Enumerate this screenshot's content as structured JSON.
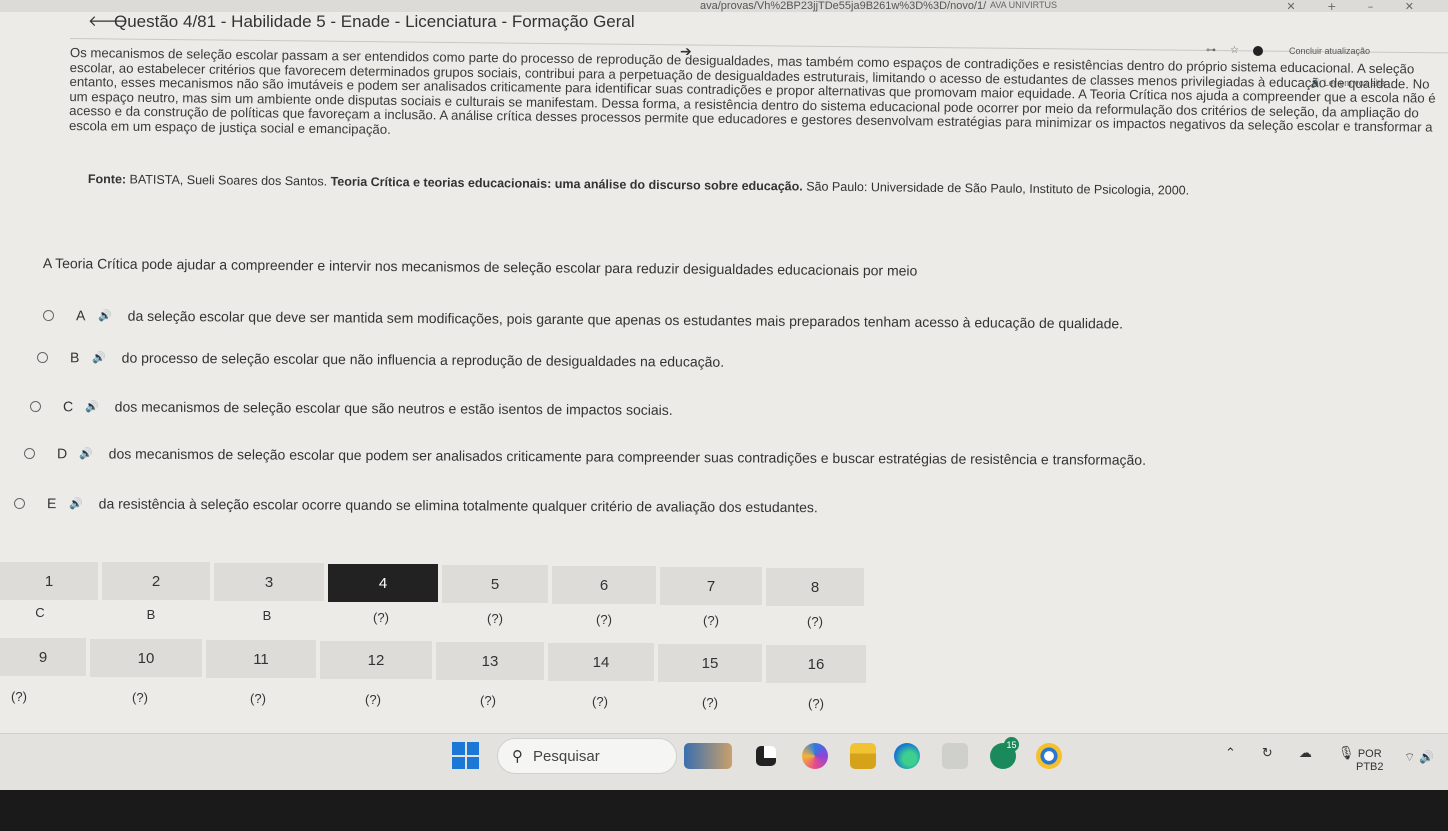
{
  "browser": {
    "url": "ava/provas/Vh%2BP23jjTDe55ja9B261w%3D%3D/novo/1/",
    "tab_label": "AVA UNIVIRTUS",
    "controls": [
      "✕",
      "+",
      "–",
      "✕"
    ]
  },
  "header": {
    "title": "Questão 4/81 - Habilidade 5 - Enade - Licenciatura - Formação Geral",
    "conclude_label": "Concluir atualização",
    "read_aloud_label": "Ler em voz alta"
  },
  "passage": "Os mecanismos de seleção escolar passam a ser entendidos como parte do processo de reprodução de desigualdades, mas também como espaços de contradições e resistências dentro do próprio sistema educacional. A seleção escolar, ao estabelecer critérios que favorecem determinados grupos sociais, contribui para a perpetuação de desigualdades estruturais, limitando o acesso de estudantes de classes menos privilegiadas à educação de qualidade. No entanto, esses mecanismos não são imutáveis e podem ser analisados criticamente para identificar suas contradições e propor alternativas que promovam maior equidade. A Teoria Crítica nos ajuda a compreender que a escola não é um espaço neutro, mas sim um ambiente onde disputas sociais e culturais se manifestam. Dessa forma, a resistência dentro do sistema educacional pode ocorrer por meio da reformulação dos critérios de seleção, da ampliação do acesso e da construção de políticas que favoreçam a inclusão. A análise crítica desses processos permite que educadores e gestores desenvolvam estratégias para minimizar os impactos negativos da seleção escolar e transformar a escola em um espaço de justiça social e emancipação.",
  "source": {
    "label": "Fonte:",
    "author": "BATISTA, Sueli Soares dos Santos.",
    "title": "Teoria Crítica e teorias educacionais: uma análise do discurso sobre educação.",
    "publisher": "São Paulo: Universidade de São Paulo, Instituto de Psicologia, 2000."
  },
  "prompt": "A Teoria Crítica pode ajudar a compreender e intervir nos mecanismos de seleção escolar para reduzir desigualdades educacionais por meio",
  "options": [
    {
      "letter": "A",
      "text": "da seleção escolar que deve ser mantida sem modificações, pois garante que apenas os estudantes mais preparados tenham acesso à educação de qualidade."
    },
    {
      "letter": "B",
      "text": "do processo de seleção escolar que não influencia a reprodução de desigualdades na educação."
    },
    {
      "letter": "C",
      "text": "dos mecanismos de seleção escolar que são neutros e estão isentos de impactos sociais."
    },
    {
      "letter": "D",
      "text": "dos mecanismos de seleção escolar que podem ser analisados criticamente para compreender suas contradições e buscar estratégias de resistência e transformação."
    },
    {
      "letter": "E",
      "text": "da resistência à seleção escolar ocorre quando se elimina totalmente qualquer critério de avaliação dos estudantes."
    }
  ],
  "grid": {
    "row1_numbers": [
      "1",
      "2",
      "3",
      "4",
      "5",
      "6",
      "7",
      "8"
    ],
    "row1_answers": [
      "C",
      "B",
      "B",
      "(?)",
      "(?)",
      "(?)",
      "(?)",
      "(?)"
    ],
    "row2_numbers": [
      "9",
      "10",
      "11",
      "12",
      "13",
      "14",
      "15",
      "16"
    ],
    "row2_answers": [
      "(?)",
      "(?)",
      "(?)",
      "(?)",
      "(?)",
      "(?)",
      "(?)",
      "(?)"
    ],
    "active_question": "4"
  },
  "taskbar": {
    "search_label": "Pesquisar",
    "badge_count": "15",
    "lang_line1": "POR",
    "lang_line2": "PTB2"
  }
}
